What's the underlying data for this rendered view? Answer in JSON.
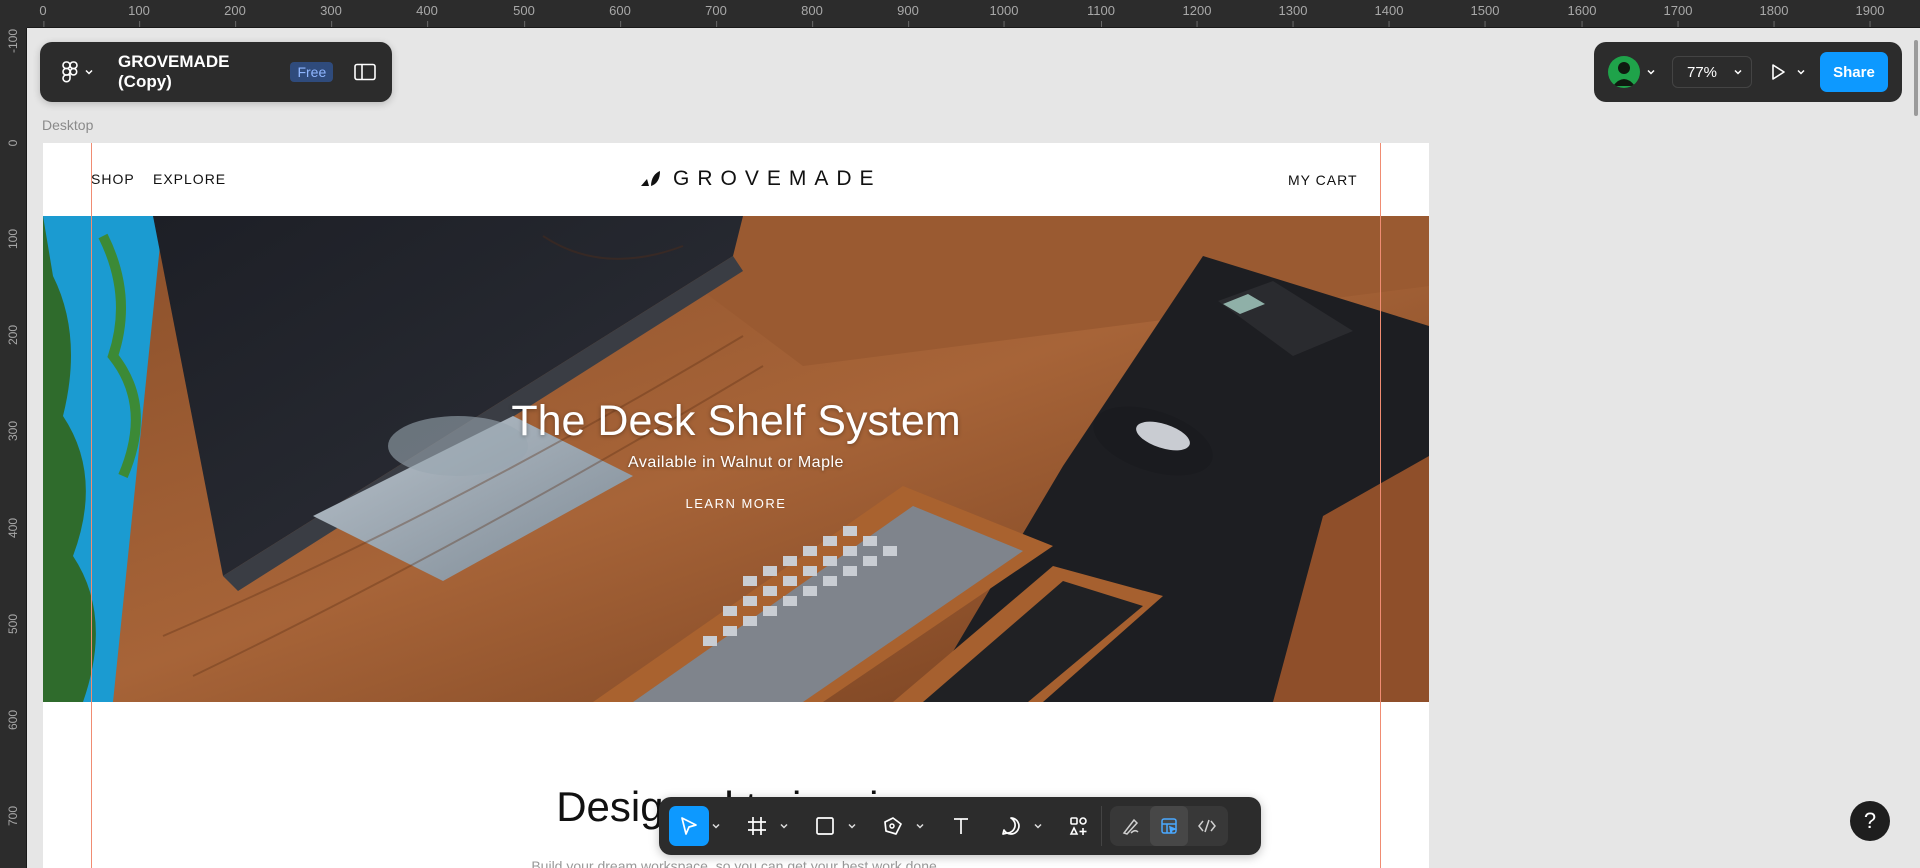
{
  "rulers": {
    "horizontal": [
      "0",
      "100",
      "200",
      "300",
      "400",
      "500",
      "600",
      "700",
      "800",
      "900",
      "1000",
      "1100",
      "1200",
      "1300",
      "1400",
      "1500",
      "1600",
      "1700",
      "1800",
      "1900"
    ],
    "vertical": [
      "-100",
      "0",
      "100",
      "200",
      "300",
      "400",
      "500",
      "600",
      "700"
    ]
  },
  "file": {
    "title": "GROVEMADE (Copy)",
    "plan": "Free"
  },
  "toolbar_right": {
    "zoom": "77%",
    "share_label": "Share"
  },
  "frame": {
    "label": "Desktop"
  },
  "site": {
    "nav": {
      "shop": "SHOP",
      "explore": "EXPLORE",
      "cart": "MY CART"
    },
    "logo_text": "GROVEMADE",
    "hero": {
      "title": "The Desk Shelf System",
      "subtitle": "Available in Walnut or Maple",
      "cta": "LEARN MORE"
    },
    "section": {
      "title": "Designed to inspire",
      "subtitle": "Build your dream workspace, so you can get your best work done."
    }
  },
  "help": {
    "label": "?"
  },
  "colors": {
    "accent": "#0d99ff",
    "toolbar_bg": "#2c2c2c",
    "guide": "#f08c72"
  },
  "icons": [
    "figma-menu-icon",
    "sidebar-toggle-icon",
    "avatar-icon",
    "play-icon",
    "move-tool-icon",
    "frame-tool-icon",
    "rectangle-tool-icon",
    "pen-tool-icon",
    "text-tool-icon",
    "comment-tool-icon",
    "actions-icon",
    "draw-mode-icon",
    "design-mode-icon",
    "dev-mode-icon"
  ]
}
